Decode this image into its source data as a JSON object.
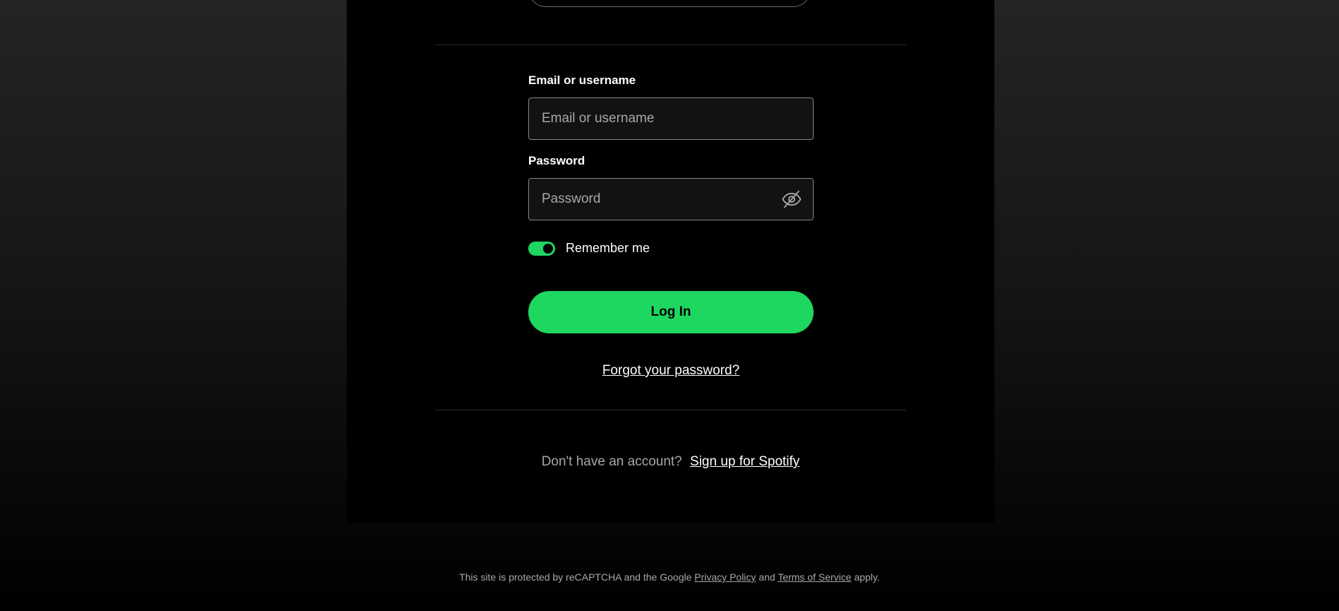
{
  "login_form": {
    "email": {
      "label": "Email or username",
      "placeholder": "Email or username",
      "value": ""
    },
    "password": {
      "label": "Password",
      "placeholder": "Password",
      "value": "",
      "visibility_icon": "eye-slash-icon"
    },
    "remember_me": {
      "label": "Remember me",
      "checked": true
    },
    "login_button_label": "Log In",
    "forgot_password_label": "Forgot your password?"
  },
  "signup": {
    "prompt": "Don't have an account?",
    "link_label": "Sign up for Spotify"
  },
  "footer": {
    "recaptcha_prefix": "This site is protected by reCAPTCHA and the Google",
    "privacy_policy_label": "Privacy Policy",
    "and_text": "and",
    "terms_label": "Terms of Service",
    "suffix": "apply."
  },
  "colors": {
    "accent": "#1ed760",
    "panel_background": "#000000",
    "page_background_top": "#242424",
    "muted_text": "#a7a7a7",
    "input_border": "#878787"
  }
}
